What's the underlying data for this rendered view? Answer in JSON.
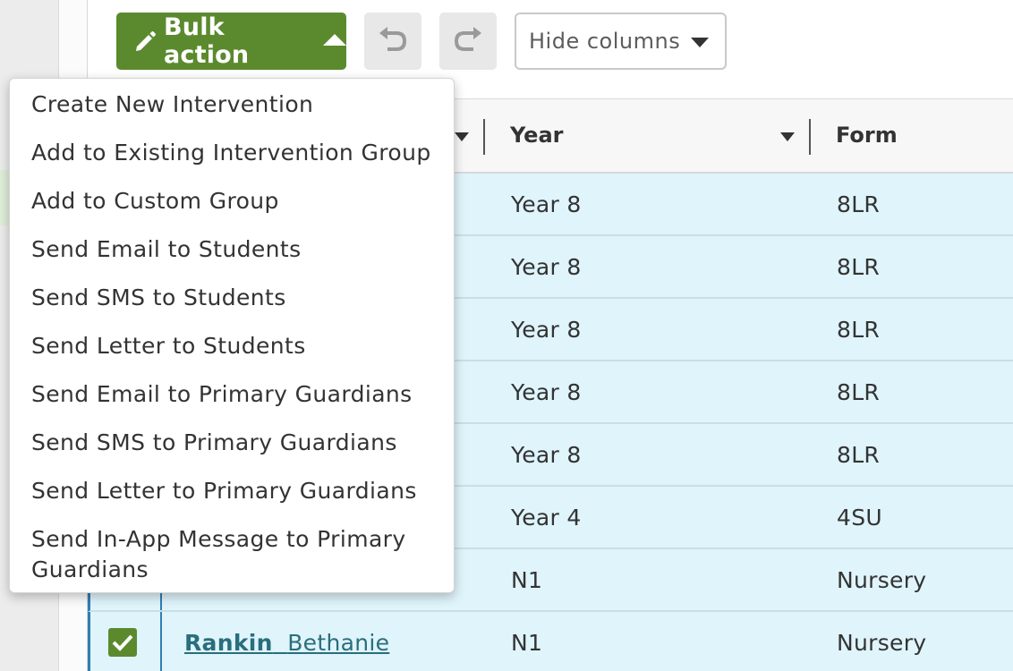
{
  "toolbar": {
    "bulk_action_label": "Bulk action",
    "hide_columns_placeholder": "Hide columns"
  },
  "table": {
    "headers": {
      "year": "Year",
      "form": "Form"
    },
    "rows": [
      {
        "year": "Year 8",
        "form": "8LR"
      },
      {
        "year": "Year 8",
        "form": "8LR"
      },
      {
        "year": "Year 8",
        "form": "8LR"
      },
      {
        "year": "Year 8",
        "form": "8LR"
      },
      {
        "year": "Year 8",
        "form": "8LR"
      },
      {
        "year": "Year 4",
        "form": "4SU"
      },
      {
        "year": "N1",
        "form": "Nursery"
      },
      {
        "year": "N1",
        "form": "Nursery",
        "surname": "Rankin",
        "firstname": "Bethanie"
      }
    ]
  },
  "bulk_menu": {
    "items": [
      "Create New Intervention",
      "Add to Existing Intervention Group",
      "Add to Custom Group",
      "Send Email to Students",
      "Send SMS to Students",
      "Send Letter to Students",
      "Send Email to Primary Guardians",
      "Send SMS to Primary Guardians",
      "Send Letter to Primary Guardians",
      "Send In-App Message to Primary Guardians"
    ]
  },
  "colors": {
    "primary_green": "#5b8a2e",
    "row_highlight": "#dff4fb",
    "link": "#2a6e7d",
    "selection_border": "#2f7eb4"
  }
}
